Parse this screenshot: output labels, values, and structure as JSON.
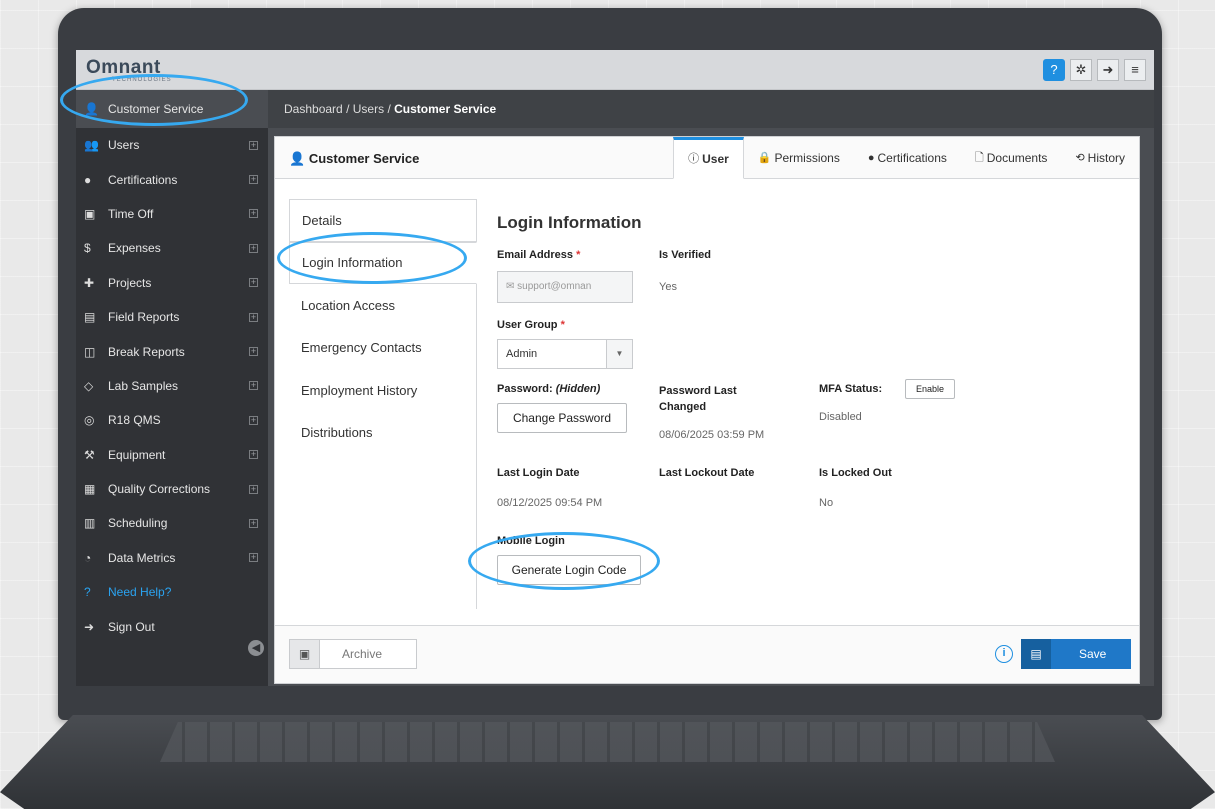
{
  "app": {
    "logo": "Omnant",
    "logo_sub": "TECHNOLOGIES"
  },
  "topbar": {
    "icons": [
      "help-icon",
      "gear-icon",
      "sign-out-icon",
      "menu-icon"
    ]
  },
  "sidebar": {
    "items": [
      {
        "icon": "user-icon",
        "glyph": "👤",
        "label": "Customer Service",
        "active": true,
        "expand": false
      },
      {
        "icon": "users-icon",
        "glyph": "👥",
        "label": "Users",
        "expand": true
      },
      {
        "icon": "certificate-icon",
        "glyph": "●",
        "label": "Certifications",
        "expand": true
      },
      {
        "icon": "calendar-icon",
        "glyph": "▣",
        "label": "Time Off",
        "expand": true
      },
      {
        "icon": "dollar-icon",
        "glyph": "$",
        "label": "Expenses",
        "expand": true
      },
      {
        "icon": "puzzle-icon",
        "glyph": "✚",
        "label": "Projects",
        "expand": true
      },
      {
        "icon": "file-icon",
        "glyph": "▤",
        "label": "Field Reports",
        "expand": true
      },
      {
        "icon": "break-icon",
        "glyph": "◫",
        "label": "Break Reports",
        "expand": true
      },
      {
        "icon": "tag-icon",
        "glyph": "◇",
        "label": "Lab Samples",
        "expand": true
      },
      {
        "icon": "qms-icon",
        "glyph": "◎",
        "label": "R18 QMS",
        "expand": true
      },
      {
        "icon": "wrench-icon",
        "glyph": "⚒",
        "label": "Equipment",
        "expand": true
      },
      {
        "icon": "clipboard-icon",
        "glyph": "▦",
        "label": "Quality Corrections",
        "expand": true
      },
      {
        "icon": "schedule-icon",
        "glyph": "▥",
        "label": "Scheduling",
        "expand": true
      },
      {
        "icon": "metrics-icon",
        "glyph": "◔",
        "label": "Data Metrics",
        "expand": true
      },
      {
        "icon": "help-circle-icon",
        "glyph": "?",
        "label": "Need Help?",
        "help": true,
        "expand": false
      },
      {
        "icon": "sign-out-icon",
        "glyph": "➜",
        "label": "Sign Out",
        "expand": false
      }
    ]
  },
  "breadcrumb": {
    "part1": "Dashboard",
    "sep": "/",
    "part2": "Users",
    "current": "Customer Service"
  },
  "panel": {
    "title": "Customer Service",
    "tabs": [
      {
        "icon": "info-icon",
        "glyph": "ⓘ",
        "label": "User",
        "active": true
      },
      {
        "icon": "lock-icon",
        "glyph": "🔒",
        "label": "Permissions"
      },
      {
        "icon": "certificate-icon",
        "glyph": "●",
        "label": "Certifications"
      },
      {
        "icon": "document-icon",
        "glyph": "🗋",
        "label": "Documents"
      },
      {
        "icon": "history-icon",
        "glyph": "⟲",
        "label": "History"
      }
    ],
    "subnav": [
      "Details",
      "Login Information",
      "Location Access",
      "Emergency Contacts",
      "Employment History",
      "Distributions"
    ],
    "form": {
      "title": "Login Information",
      "email_label": "Email Address",
      "email_value": "support@omnan",
      "verified_label": "Is Verified",
      "verified_value": "Yes",
      "group_label": "User Group",
      "group_value": "Admin",
      "password_label": "Password:",
      "password_hidden": "(Hidden)",
      "change_password": "Change Password",
      "pw_changed_label": "Password Last Changed",
      "pw_changed_value": "08/06/2025 03:59 PM",
      "mfa_label": "MFA Status:",
      "mfa_enable": "Enable",
      "mfa_value": "Disabled",
      "last_login_label": "Last Login Date",
      "last_login_value": "08/12/2025 09:54 PM",
      "lockout_label": "Last Lockout Date",
      "locked_label": "Is Locked Out",
      "locked_value": "No",
      "mobile_label": "Mobile Login",
      "generate_code": "Generate Login Code"
    },
    "footer": {
      "archive": "Archive",
      "save": "Save"
    }
  },
  "colors": {
    "accent": "#1f8fe0",
    "highlight": "#36a9f0",
    "sidebar": "#303236"
  }
}
